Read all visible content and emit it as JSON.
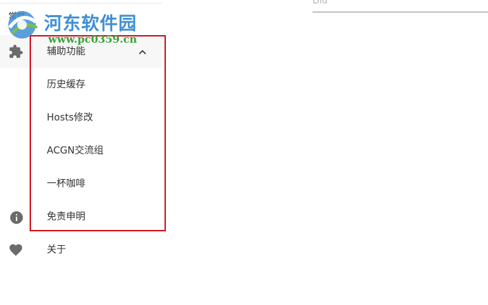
{
  "watermark": {
    "site_name": "河东软件园",
    "url": "www.pc0359.cn"
  },
  "top": {
    "partial_label": "常性"
  },
  "right_field": {
    "partial_value": "Did"
  },
  "nav": {
    "accessibility": {
      "label": "辅助功能",
      "icon": "puzzle-icon",
      "expanded": true
    },
    "sub_items": [
      {
        "label": "历史缓存"
      },
      {
        "label": "Hosts修改"
      },
      {
        "label": "ACGN交流组"
      },
      {
        "label": "一杯咖啡"
      },
      {
        "label": "免责申明"
      }
    ],
    "about": {
      "label": "关于",
      "icon": "heart-icon"
    },
    "info_icon": "info-icon"
  },
  "colors": {
    "icon": "#6b6b6b",
    "highlight": "#d1121a",
    "text": "#333333",
    "watermark_blue": "#3f8fd4",
    "watermark_green": "#36a336"
  }
}
